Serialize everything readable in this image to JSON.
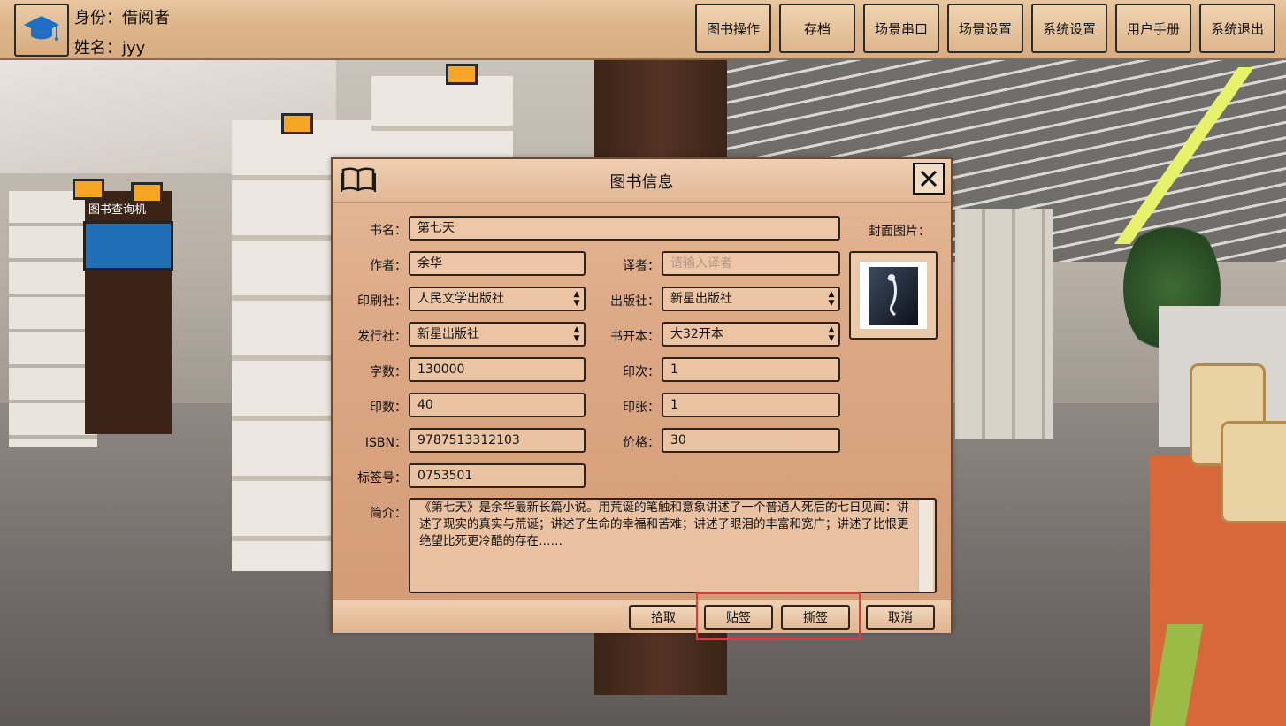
{
  "header": {
    "identity_text": "身份：借阅者",
    "name_text": "姓名：jyy",
    "avatar_icon": "graduation-cap-icon",
    "buttons": [
      {
        "label": "图书操作"
      },
      {
        "label": "存档"
      },
      {
        "label": "场景串口"
      },
      {
        "label": "场景设置"
      },
      {
        "label": "系统设置"
      },
      {
        "label": "用户手册"
      },
      {
        "label": "系统退出"
      }
    ]
  },
  "scene": {
    "kiosk_label": "图书查询机"
  },
  "dialog": {
    "title": "图书信息",
    "title_icon": "open-book-icon",
    "close_icon": "close-icon",
    "cover_label": "封面图片：",
    "fields": {
      "title": {
        "label": "书名：",
        "value": "第七天"
      },
      "author": {
        "label": "作者：",
        "value": "余华"
      },
      "translator": {
        "label": "译者：",
        "placeholder": "请输入译者"
      },
      "printer": {
        "label": "印刷社：",
        "value": "人民文学出版社"
      },
      "publisher": {
        "label": "出版社：",
        "value": "新星出版社"
      },
      "distributor": {
        "label": "发行社：",
        "value": "新星出版社"
      },
      "format": {
        "label": "书开本：",
        "value": "大32开本"
      },
      "word_count": {
        "label": "字数：",
        "value": "130000"
      },
      "impression": {
        "label": "印次：",
        "value": "1"
      },
      "print_count": {
        "label": "印数：",
        "value": "40"
      },
      "sheets": {
        "label": "印张：",
        "value": "1"
      },
      "isbn": {
        "label": "ISBN：",
        "value": "9787513312103"
      },
      "price": {
        "label": "价格：",
        "value": "30"
      },
      "tag_no": {
        "label": "标签号：",
        "value": "0753501"
      },
      "intro": {
        "label": "简介：",
        "value": "《第七天》是余华最新长篇小说。用荒诞的笔触和意象讲述了一个普通人死后的七日见闻：讲述了现实的真实与荒诞；讲述了生命的幸福和苦难；讲述了眼泪的丰富和宽广；讲述了比恨更绝望比死更冷酷的存在……"
      }
    },
    "buttons": {
      "pickup": "拾取",
      "attach_tag": "贴签",
      "remove_tag": "撕签",
      "cancel": "取消"
    },
    "highlight_color": "#e03a3a"
  }
}
